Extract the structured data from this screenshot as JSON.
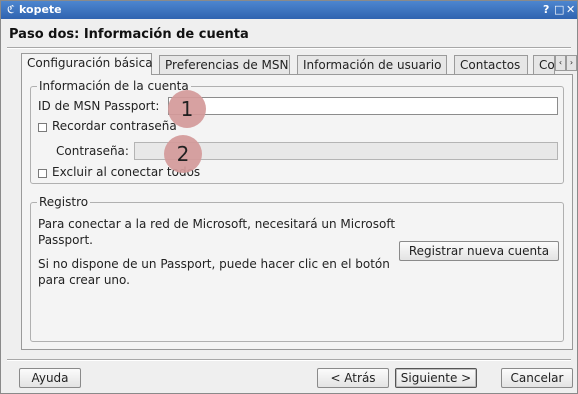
{
  "window": {
    "app_icon": "kopete-icon",
    "title": "kopete",
    "buttons": [
      "?",
      "□",
      "✕"
    ]
  },
  "heading": "Paso dos: Información de cuenta",
  "tabs": [
    {
      "label": "Configuración básica",
      "active": true
    },
    {
      "label": "Preferencias de MSN",
      "active": false
    },
    {
      "label": "Información de usuario",
      "active": false
    },
    {
      "label": "Contactos",
      "active": false
    },
    {
      "label": "Co",
      "active": false
    }
  ],
  "tab_scroll": {
    "left": "‹",
    "right": "›"
  },
  "account_info": {
    "group_title": "Información de la cuenta",
    "passport_label": "ID de MSN Passport:",
    "passport_value": "",
    "remember_label": "Recordar contraseña",
    "remember_checked": false,
    "password_label": "Contraseña:",
    "password_value": "",
    "exclude_label": "Excluir al conectar todos",
    "exclude_checked": false
  },
  "registration": {
    "group_title": "Registro",
    "text_1": "Para conectar a la red de Microsoft, necesitará un Microsoft Passport.",
    "text_2": "Si no dispone de un Passport, puede hacer clic en el botón para crear uno.",
    "register_button": "Registrar nueva cuenta"
  },
  "callouts": [
    "1",
    "2"
  ],
  "footer": {
    "help": "Ayuda",
    "back": "< Atrás",
    "next": "Siguiente >",
    "cancel": "Cancelar"
  }
}
